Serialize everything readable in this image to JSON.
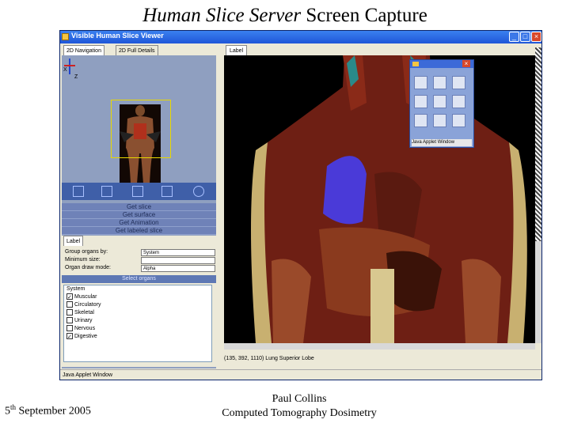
{
  "slide": {
    "title_italic": "Human Slice Server",
    "title_rest": " Screen Capture",
    "date_day": "5",
    "date_sup": "th",
    "date_rest": " September 2005",
    "author": "Paul Collins",
    "subtitle": "Computed Tomography Dosimetry"
  },
  "window": {
    "title": "Visible Human Slice Viewer",
    "minimize_label": "_",
    "maximize_label": "□",
    "close_label": "×"
  },
  "left_tabs": [
    "2D Navigation",
    "2D Full Details"
  ],
  "axis": {
    "x": "X",
    "z": "Z"
  },
  "action_buttons": [
    "Get slice",
    "Get surface",
    "Get Animation",
    "Get labeled slice"
  ],
  "label_tab": "Label",
  "form": {
    "group_label": "Group organs by:",
    "group_value": "System",
    "min_size_label": "Minimum size:",
    "organ_mode_label": "Organ draw mode:",
    "organ_mode_value": "Alpha"
  },
  "organs_header": "Select organs",
  "organ_list": [
    {
      "label": "System",
      "checked": false,
      "is_header": true
    },
    {
      "label": "Muscular",
      "checked": true,
      "is_header": false
    },
    {
      "label": "Circulatory",
      "checked": false,
      "is_header": false
    },
    {
      "label": "Skeletal",
      "checked": false,
      "is_header": false
    },
    {
      "label": "Urinary",
      "checked": false,
      "is_header": false
    },
    {
      "label": "Nervous",
      "checked": false,
      "is_header": false
    },
    {
      "label": "Digestive",
      "checked": true,
      "is_header": false
    }
  ],
  "right_tab": "Label",
  "coords": "(135, 392, 1110)   Lung Superior Lobe",
  "applet_status": "Java Applet Window",
  "statusbar": "Java Applet Window",
  "colors": {
    "title_blue": "#1f56d8",
    "panel_blue": "#8f9fc0",
    "highlight_lung": "#4a3ad8"
  }
}
